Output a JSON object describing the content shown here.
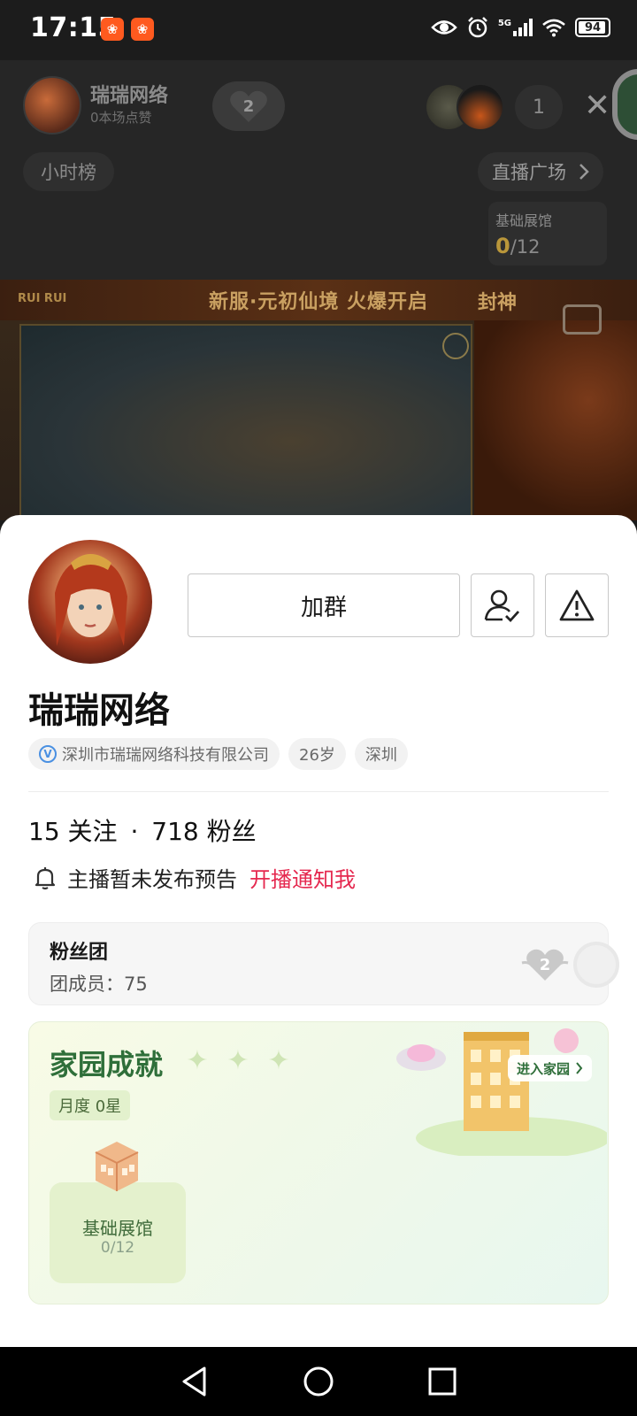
{
  "status_bar": {
    "time": "17:15",
    "app_badges": [
      "bilibili-like-icon",
      "bilibili-like-icon"
    ],
    "network": "5G",
    "battery": "94",
    "battery_level_percent": 94
  },
  "live_header": {
    "host_name": "瑞瑞网络",
    "host_likes": "0本场点赞",
    "fan_badge_level": "2",
    "viewer_count": "1",
    "hour_rank": "小时榜",
    "live_plaza": "直播广场",
    "exhibit": {
      "title": "基础展馆",
      "current": "0",
      "total": "/12"
    }
  },
  "video": {
    "banner_text": "新服·元初仙境 火爆开启",
    "logo_text": "RUI RUI",
    "art_text": "封神"
  },
  "profile": {
    "join_group_label": "加群",
    "name": "瑞瑞网络",
    "tags": {
      "company": "深圳市瑞瑞网络科技有限公司",
      "age": "26岁",
      "city": "深圳"
    },
    "following_count": "15",
    "following_label": "关注",
    "separator": "·",
    "fans_count": "718",
    "fans_label": "粉丝",
    "notice_text": "主播暂未发布预告",
    "notify_link": "开播通知我"
  },
  "fan_group": {
    "title": "粉丝团",
    "members_label": "团成员：",
    "members_count": "75",
    "badge_level": "2"
  },
  "home": {
    "title": "家园成就",
    "month_label": "月度",
    "month_stars": "0星",
    "enter_label": "进入家园",
    "basic_name": "基础展馆",
    "basic_progress": "0/12"
  },
  "colors": {
    "accent_red": "#e5284f",
    "home_green": "#2f6f3a",
    "gold": "#b9963a"
  }
}
